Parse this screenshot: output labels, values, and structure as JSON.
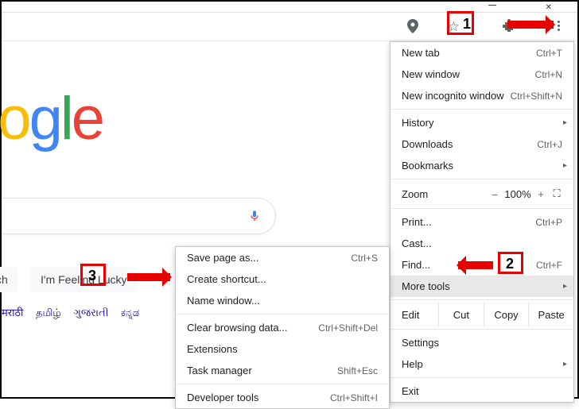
{
  "toolbar": {
    "location_tooltip": "Location",
    "bookmark_tooltip": "Bookmark",
    "extensions_tooltip": "Extensions",
    "menu_tooltip": "Customize and control Google Chrome"
  },
  "page": {
    "logo_text": "oogle",
    "search_btn": "ch",
    "lucky_btn": "I'm Feeling Lucky",
    "langs": [
      "मराठी",
      "தமிழ்",
      "ગુજરાતી",
      "ಕನ್ನಡ"
    ]
  },
  "main_menu": {
    "new_tab": "New tab",
    "new_tab_sc": "Ctrl+T",
    "new_window": "New window",
    "new_window_sc": "Ctrl+N",
    "new_incognito": "New incognito window",
    "new_incognito_sc": "Ctrl+Shift+N",
    "history": "History",
    "downloads": "Downloads",
    "downloads_sc": "Ctrl+J",
    "bookmarks": "Bookmarks",
    "zoom_label": "Zoom",
    "zoom_minus": "–",
    "zoom_value": "100%",
    "zoom_plus": "+",
    "zoom_fs": "⛶",
    "print": "Print...",
    "print_sc": "Ctrl+P",
    "cast": "Cast...",
    "find": "Find...",
    "find_sc": "Ctrl+F",
    "more_tools": "More tools",
    "edit_label": "Edit",
    "cut": "Cut",
    "copy": "Copy",
    "paste": "Paste",
    "settings": "Settings",
    "help": "Help",
    "exit": "Exit"
  },
  "more_tools_menu": {
    "save_page": "Save page as...",
    "save_page_sc": "Ctrl+S",
    "create_shortcut": "Create shortcut...",
    "name_window": "Name window...",
    "clear_data": "Clear browsing data...",
    "clear_data_sc": "Ctrl+Shift+Del",
    "extensions": "Extensions",
    "task_manager": "Task manager",
    "task_manager_sc": "Shift+Esc",
    "dev_tools": "Developer tools",
    "dev_tools_sc": "Ctrl+Shift+I"
  },
  "annotations": {
    "n1": "1",
    "n2": "2",
    "n3": "3"
  }
}
